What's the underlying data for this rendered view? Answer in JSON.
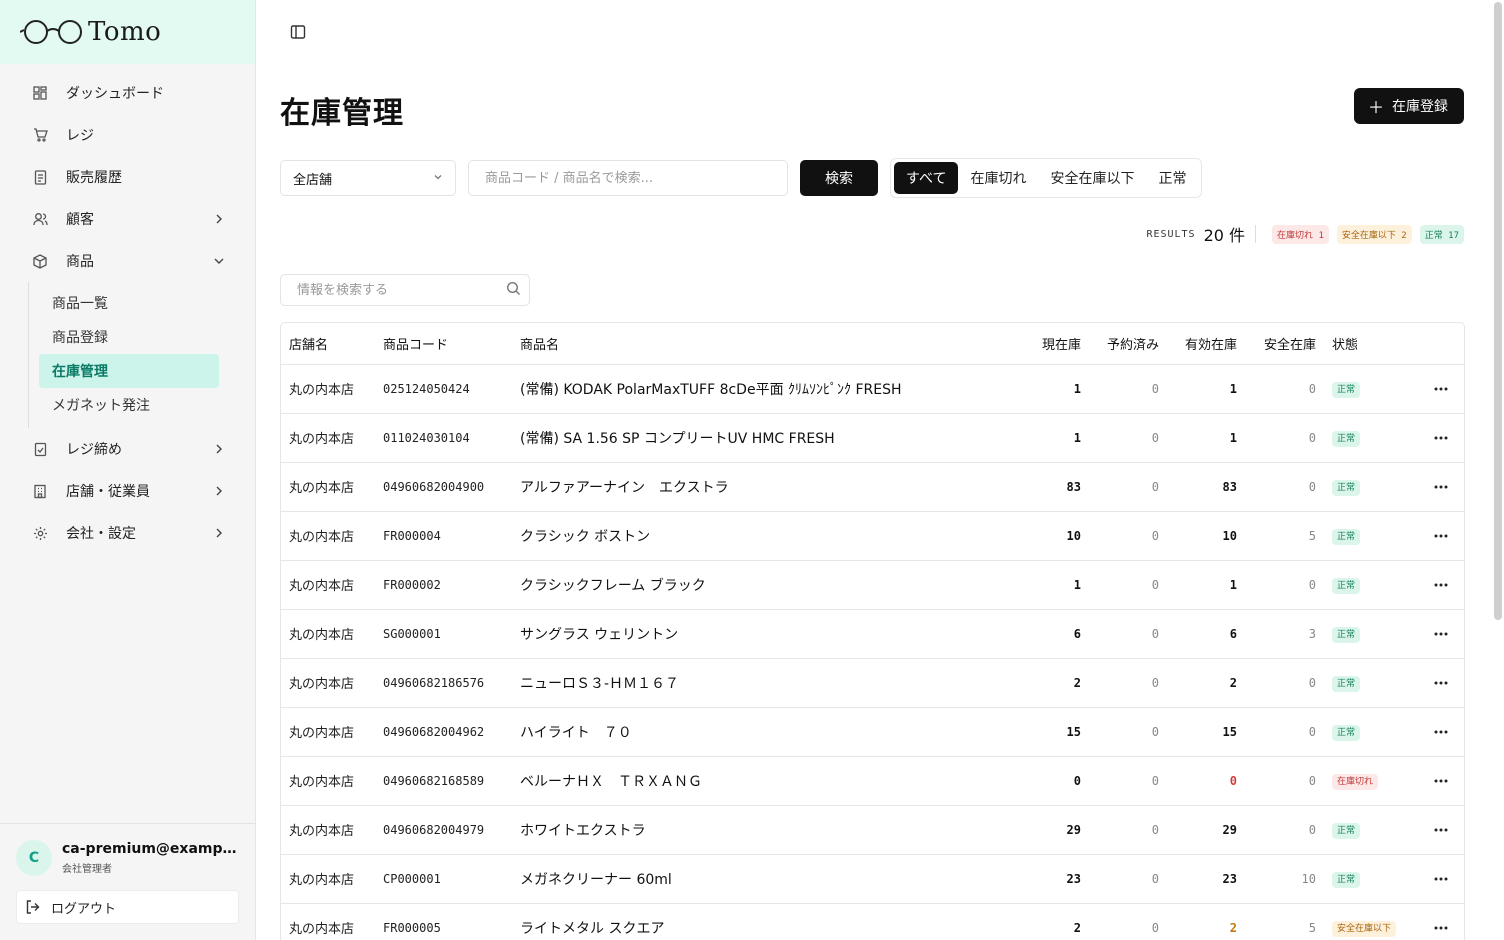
{
  "app": {
    "logo_text": "Tomo"
  },
  "sidebar": {
    "items": [
      {
        "label": "ダッシュボード",
        "icon": "dashboard-icon"
      },
      {
        "label": "レジ",
        "icon": "cart-icon"
      },
      {
        "label": "販売履歴",
        "icon": "receipt-icon"
      },
      {
        "label": "顧客",
        "icon": "users-icon"
      },
      {
        "label": "商品",
        "icon": "package-icon"
      }
    ],
    "sub_items": [
      {
        "label": "商品一覧"
      },
      {
        "label": "商品登録"
      },
      {
        "label": "在庫管理"
      },
      {
        "label": "メガネット発注"
      }
    ],
    "items_after": [
      {
        "label": "レジ締め",
        "icon": "clipboard-check-icon"
      },
      {
        "label": "店舗・従業員",
        "icon": "building-icon"
      },
      {
        "label": "会社・設定",
        "icon": "gear-icon"
      }
    ],
    "user": {
      "initial": "C",
      "email": "ca-premium@example.com",
      "role": "会社管理者"
    },
    "logout_label": "ログアウト"
  },
  "page": {
    "title": "在庫管理",
    "add_button": "在庫登録",
    "store_select": "全店舗",
    "search_placeholder": "商品コード / 商品名で検索...",
    "search_button": "検索",
    "segments": [
      "すべて",
      "在庫切れ",
      "安全在庫以下",
      "正常"
    ],
    "results_label": "RESULTS",
    "results_count": "20 件",
    "badges": {
      "out": "在庫切れ 1",
      "low": "安全在庫以下 2",
      "ok": "正常 17"
    },
    "info_search_placeholder": "情報を検索する"
  },
  "table": {
    "headers": [
      "店舗名",
      "商品コード",
      "商品名",
      "現在庫",
      "予約済み",
      "有効在庫",
      "安全在庫",
      "状態"
    ],
    "rows": [
      {
        "store": "丸の内本店",
        "code": "025124050424",
        "name": "(常備) KODAK PolarMaxTUFF 8cDe平面 ｸﾘﾑｿﾝﾋﾟﾝｸ FRESH",
        "stock": "1",
        "reserved": "0",
        "available": "1",
        "safety": "0",
        "status": "正常",
        "kind": "ok"
      },
      {
        "store": "丸の内本店",
        "code": "011024030104",
        "name": "(常備) SA 1.56 SP コンプリートUV HMC FRESH",
        "stock": "1",
        "reserved": "0",
        "available": "1",
        "safety": "0",
        "status": "正常",
        "kind": "ok"
      },
      {
        "store": "丸の内本店",
        "code": "04960682004900",
        "name": "アルファアーナイン　エクストラ",
        "stock": "83",
        "reserved": "0",
        "available": "83",
        "safety": "0",
        "status": "正常",
        "kind": "ok"
      },
      {
        "store": "丸の内本店",
        "code": "FR000004",
        "name": "クラシック ボストン",
        "stock": "10",
        "reserved": "0",
        "available": "10",
        "safety": "5",
        "status": "正常",
        "kind": "ok"
      },
      {
        "store": "丸の内本店",
        "code": "FR000002",
        "name": "クラシックフレーム ブラック",
        "stock": "1",
        "reserved": "0",
        "available": "1",
        "safety": "0",
        "status": "正常",
        "kind": "ok"
      },
      {
        "store": "丸の内本店",
        "code": "SG000001",
        "name": "サングラス ウェリントン",
        "stock": "6",
        "reserved": "0",
        "available": "6",
        "safety": "3",
        "status": "正常",
        "kind": "ok"
      },
      {
        "store": "丸の内本店",
        "code": "04960682186576",
        "name": "ニューロＳ３-ＨＭ１６７",
        "stock": "2",
        "reserved": "0",
        "available": "2",
        "safety": "0",
        "status": "正常",
        "kind": "ok"
      },
      {
        "store": "丸の内本店",
        "code": "04960682004962",
        "name": "ハイライト　７０",
        "stock": "15",
        "reserved": "0",
        "available": "15",
        "safety": "0",
        "status": "正常",
        "kind": "ok"
      },
      {
        "store": "丸の内本店",
        "code": "04960682168589",
        "name": "ベルーナＨＸ　ＴＲＸＡＮＧ",
        "stock": "0",
        "reserved": "0",
        "available": "0",
        "safety": "0",
        "status": "在庫切れ",
        "kind": "out"
      },
      {
        "store": "丸の内本店",
        "code": "04960682004979",
        "name": "ホワイトエクストラ",
        "stock": "29",
        "reserved": "0",
        "available": "29",
        "safety": "0",
        "status": "正常",
        "kind": "ok"
      },
      {
        "store": "丸の内本店",
        "code": "CP000001",
        "name": "メガネクリーナー 60ml",
        "stock": "23",
        "reserved": "0",
        "available": "23",
        "safety": "10",
        "status": "正常",
        "kind": "ok"
      },
      {
        "store": "丸の内本店",
        "code": "FR000005",
        "name": "ライトメタル スクエア",
        "stock": "2",
        "reserved": "0",
        "available": "2",
        "safety": "5",
        "status": "安全在庫以下",
        "kind": "low"
      }
    ]
  },
  "colors": {
    "accent": "#0b7a66",
    "active_bg": "#ccf4ea",
    "logo_bg": "#e3faf3"
  }
}
